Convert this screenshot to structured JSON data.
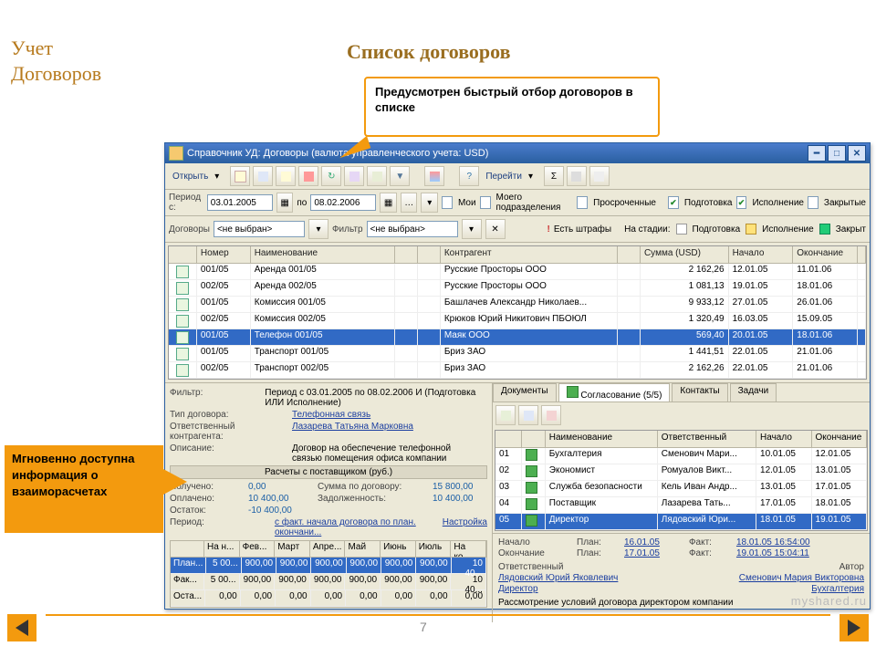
{
  "slide": {
    "brand1": "Учет",
    "brand2": "Договоров",
    "heading": "Список договоров",
    "callout1": "Предусмотрен быстрый отбор договоров в списке",
    "callout2": "Мгновенно доступна информация о взаиморасчетах",
    "pagenum": "7",
    "watermark": "myshared.ru"
  },
  "win": {
    "title": "Справочник УД: Договоры (валюта управленческого учета: USD)",
    "open_label": "Открыть",
    "goto_label": "Перейти",
    "period_label": "Период с:",
    "date_from": "03.01.2005",
    "date_to": "08.02.2006",
    "date_sep": "по",
    "cb_my": "Мои",
    "cb_dept": "Моего подразделения",
    "cb_overdue": "Просроченные",
    "cb_prep": "Подготовка",
    "cb_exec": "Исполнение",
    "cb_closed": "Закрытые",
    "contracts_label": "Договоры",
    "contracts_value": "<не выбран>",
    "filter_label": "Фильтр",
    "filter_value": "<не выбран>",
    "fines_warn": "Есть штрафы",
    "stage_label": "На стадии:",
    "stage_prep": "Подготовка",
    "stage_exec": "Исполнение",
    "stage_closed": "Закрыт"
  },
  "grid": {
    "headers": [
      "",
      "Номер",
      "Наименование",
      "",
      "",
      "Контрагент",
      "",
      "Сумма (USD)",
      "Начало",
      "Окончание"
    ],
    "rows": [
      {
        "num": "001/05",
        "name": "Аренда 001/05",
        "agent": "Русские Просторы ООО",
        "sum": "2 162,26",
        "start": "12.01.05",
        "end": "11.01.06"
      },
      {
        "num": "002/05",
        "name": "Аренда 002/05",
        "agent": "Русские Просторы ООО",
        "sum": "1 081,13",
        "start": "19.01.05",
        "end": "18.01.06"
      },
      {
        "num": "001/05",
        "name": "Комиссия 001/05",
        "agent": "Башлачев Александр Николаев...",
        "sum": "9 933,12",
        "start": "27.01.05",
        "end": "26.01.06"
      },
      {
        "num": "002/05",
        "name": "Комиссия 002/05",
        "agent": "Крюков Юрий Никитович ПБОЮЛ",
        "sum": "1 320,49",
        "start": "16.03.05",
        "end": "15.09.05"
      },
      {
        "num": "001/05",
        "name": "Телефон 001/05",
        "agent": "Маяк ООО",
        "sum": "569,40",
        "start": "20.01.05",
        "end": "18.01.06",
        "sel": true
      },
      {
        "num": "001/05",
        "name": "Транспорт 001/05",
        "agent": "Бриз ЗАО",
        "sum": "1 441,51",
        "start": "22.01.05",
        "end": "21.01.06"
      },
      {
        "num": "002/05",
        "name": "Транспорт 002/05",
        "agent": "Бриз ЗАО",
        "sum": "2 162,26",
        "start": "22.01.05",
        "end": "21.01.06"
      }
    ]
  },
  "detail": {
    "filter_label": "Фильтр:",
    "filter_value": "Период с 03.01.2005 по 08.02.2006 И (Подготовка ИЛИ Исполнение)",
    "type_label": "Тип договора:",
    "type_value": "Телефонная связь",
    "resp_label": "Ответственный контрагента:",
    "resp_value": "Лазарева Татьяна Марковна",
    "desc_label": "Описание:",
    "desc_value": "Договор на обеспечение телефонной связью помещения офиса компании",
    "section_title": "Расчеты с поставщиком (руб.)",
    "received_l": "Получено:",
    "received_v": "0,00",
    "contract_sum_l": "Сумма по договору:",
    "contract_sum_v": "15 800,00",
    "paid_l": "Оплачено:",
    "paid_v": "10 400,00",
    "debt_l": "Задолженность:",
    "debt_v": "10 400,00",
    "balance_l": "Остаток:",
    "balance_v": "-10 400,00",
    "period_l": "Период:",
    "period_v": "с факт. начала договора по план. окончани...",
    "tune_l": "Настройка"
  },
  "mini": {
    "headers": [
      "На н...",
      "Фев...",
      "Март",
      "Апре...",
      "Май",
      "Июнь",
      "Июль",
      "На ко..."
    ],
    "rows": [
      {
        "k": "План...",
        "v": [
          "5 00...",
          "900,00",
          "900,00",
          "900,00",
          "900,00",
          "900,00",
          "900,00",
          "10 40..."
        ],
        "sel": true
      },
      {
        "k": "Фак...",
        "v": [
          "5 00...",
          "900,00",
          "900,00",
          "900,00",
          "900,00",
          "900,00",
          "900,00",
          "10 40..."
        ]
      },
      {
        "k": "Оста...",
        "v": [
          "0,00",
          "0,00",
          "0,00",
          "0,00",
          "0,00",
          "0,00",
          "0,00",
          "0,00"
        ]
      }
    ]
  },
  "tabs": {
    "t1": "Документы",
    "t2": "Согласование (5/5)",
    "t3": "Контакты",
    "t4": "Задачи"
  },
  "appr": {
    "headers": [
      "",
      "",
      "Наименование",
      "Ответственный",
      "Начало",
      "Окончание"
    ],
    "rows": [
      {
        "n": "01",
        "name": "Бухгалтерия",
        "resp": "Сменович Мари...",
        "s": "10.01.05",
        "e": "12.01.05"
      },
      {
        "n": "02",
        "name": "Экономист",
        "resp": "Ромуалов Викт...",
        "s": "12.01.05",
        "e": "13.01.05"
      },
      {
        "n": "03",
        "name": "Служба безопасности",
        "resp": "Кель Иван Андр...",
        "s": "13.01.05",
        "e": "17.01.05"
      },
      {
        "n": "04",
        "name": "Поставщик",
        "resp": "Лазарева Тать...",
        "s": "17.01.05",
        "e": "18.01.05"
      },
      {
        "n": "05",
        "name": "Директор",
        "resp": "Лядовский Юри...",
        "s": "18.01.05",
        "e": "19.01.05",
        "sel": true
      }
    ]
  },
  "apprdet": {
    "start_l": "Начало",
    "start_plan_l": "План:",
    "start_plan": "16.01.05",
    "start_fact_l": "Факт:",
    "start_fact": "18.01.05 16:54:00",
    "end_l": "Окончание",
    "end_plan": "17.01.05",
    "end_fact": "19.01.05 15:04:11",
    "resp_l": "Ответственный",
    "author_l": "Автор",
    "resp_v": "Лядовский Юрий Яковлевич",
    "author_v": "Сменович Мария Викторовна",
    "dir": "Директор",
    "buh": "Бухгалтерия",
    "note": "Рассмотрение условий договора директором компании"
  }
}
